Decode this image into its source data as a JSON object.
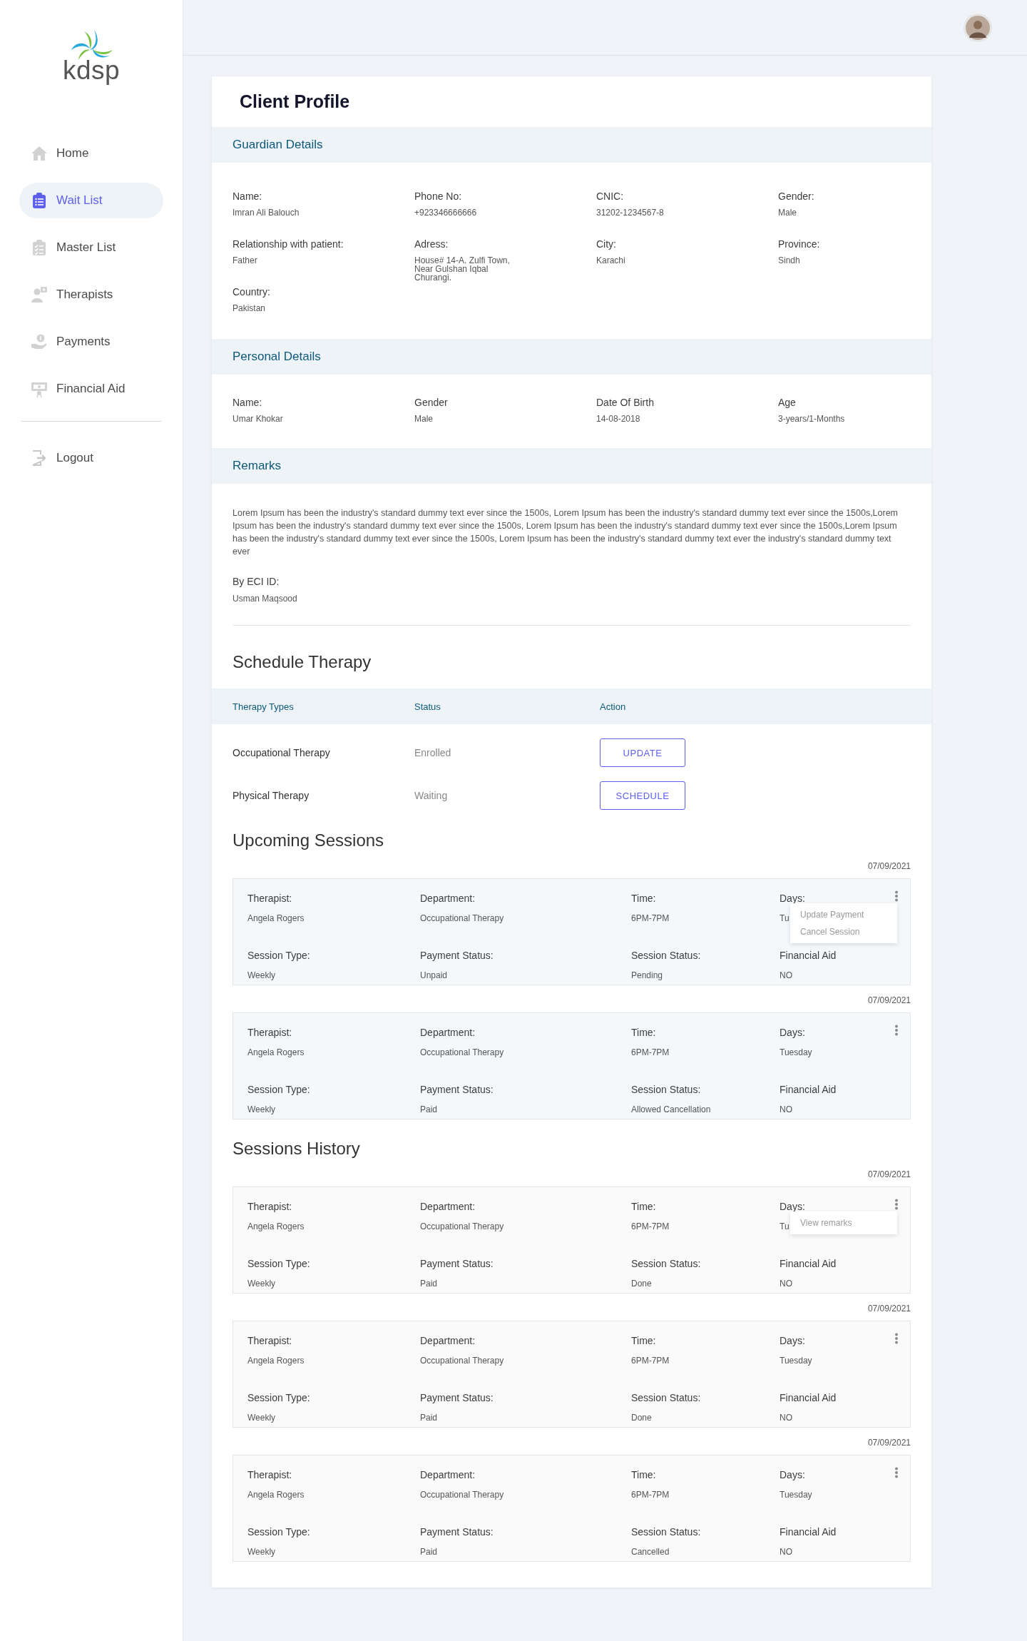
{
  "logo": {
    "text": "kdsp"
  },
  "sidebar": {
    "items": [
      {
        "label": "Home",
        "selected": false
      },
      {
        "label": "Wait List",
        "selected": true
      },
      {
        "label": "Master List",
        "selected": false
      },
      {
        "label": "Therapists",
        "selected": false
      },
      {
        "label": "Payments",
        "selected": false
      },
      {
        "label": "Financial Aid",
        "selected": false
      }
    ],
    "logout": {
      "label": "Logout"
    }
  },
  "page": {
    "title": "Client Profile"
  },
  "guardian_details": {
    "title": "Guardian Details",
    "fields": [
      {
        "label": "Name:",
        "value": "Imran Ali Balouch"
      },
      {
        "label": "Phone No:",
        "value": "+923346666666"
      },
      {
        "label": "CNIC:",
        "value": "31202-1234567-8"
      },
      {
        "label": "Gender:",
        "value": "Male"
      },
      {
        "label": "Relationship with patient:",
        "value": "Father"
      },
      {
        "label": "Adress:",
        "value": "House# 14-A. Zulfi Town, Near Gulshan Iqbal Churangi."
      },
      {
        "label": "City:",
        "value": "Karachi"
      },
      {
        "label": "Province:",
        "value": "Sindh"
      },
      {
        "label": "Country:",
        "value": "Pakistan"
      }
    ]
  },
  "personal_details": {
    "title": "Personal Details",
    "fields": [
      {
        "label": "Name:",
        "value": "Umar Khokar"
      },
      {
        "label": "Gender",
        "value": "Male"
      },
      {
        "label": "Date Of Birth",
        "value": "14-08-2018"
      },
      {
        "label": "Age",
        "value": "3-years/1-Months"
      }
    ]
  },
  "remarks": {
    "title": "Remarks",
    "text": "Lorem Ipsum has been the industry's standard dummy text ever since the 1500s, Lorem Ipsum has been the industry's standard dummy text ever since the 1500s,Lorem Ipsum has been the industry's standard dummy text ever since the 1500s, Lorem Ipsum has been the industry's standard dummy text ever since the 1500s,Lorem Ipsum has been the industry's standard dummy text ever since the 1500s, Lorem Ipsum has been the industry's standard dummy text ever the industry's standard dummy text ever",
    "by_label": "By ECI ID:",
    "by_value": "Usman Maqsood"
  },
  "schedule_therapy": {
    "title": "Schedule Therapy",
    "columns": [
      "Therapy Types",
      "Status",
      "Action"
    ],
    "rows": [
      {
        "therapy": "Occupational Therapy",
        "status": "Enrolled",
        "action": "UPDATE"
      },
      {
        "therapy": "Physical Therapy",
        "status": "Waiting",
        "action": "SCHEDULE"
      }
    ]
  },
  "upcoming_sessions": {
    "title": "Upcoming Sessions",
    "sessions": [
      {
        "date": "07/09/2021",
        "fields": [
          {
            "label": "Therapist:",
            "value": "Angela Rogers"
          },
          {
            "label": "Department:",
            "value": "Occupational Therapy"
          },
          {
            "label": "Time:",
            "value": "6PM-7PM"
          },
          {
            "label": "Days:",
            "value": "Tu"
          },
          {
            "label": "Session Type:",
            "value": "Weekly"
          },
          {
            "label": "Payment Status:",
            "value": "Unpaid"
          },
          {
            "label": "Session Status:",
            "value": "Pending"
          },
          {
            "label": "Financial Aid",
            "value": "NO"
          }
        ],
        "menu": [
          "Update Payment",
          "Cancel Session"
        ]
      },
      {
        "date": "07/09/2021",
        "fields": [
          {
            "label": "Therapist:",
            "value": "Angela Rogers"
          },
          {
            "label": "Department:",
            "value": "Occupational Therapy"
          },
          {
            "label": "Time:",
            "value": "6PM-7PM"
          },
          {
            "label": "Days:",
            "value": "Tuesday"
          },
          {
            "label": "Session Type:",
            "value": "Weekly"
          },
          {
            "label": "Payment Status:",
            "value": "Paid"
          },
          {
            "label": "Session Status:",
            "value": "Allowed Cancellation"
          },
          {
            "label": "Financial Aid",
            "value": "NO"
          }
        ]
      }
    ]
  },
  "sessions_history": {
    "title": "Sessions History",
    "sessions": [
      {
        "date": "07/09/2021",
        "fields": [
          {
            "label": "Therapist:",
            "value": "Angela Rogers"
          },
          {
            "label": "Department:",
            "value": "Occupational Therapy"
          },
          {
            "label": "Time:",
            "value": "6PM-7PM"
          },
          {
            "label": "Days:",
            "value": "Tu"
          },
          {
            "label": "Session Type:",
            "value": "Weekly"
          },
          {
            "label": "Payment Status:",
            "value": "Paid"
          },
          {
            "label": "Session Status:",
            "value": "Done"
          },
          {
            "label": "Financial Aid",
            "value": "NO"
          }
        ],
        "menu": [
          "View remarks"
        ]
      },
      {
        "date": "07/09/2021",
        "fields": [
          {
            "label": "Therapist:",
            "value": "Angela Rogers"
          },
          {
            "label": "Department:",
            "value": "Occupational Therapy"
          },
          {
            "label": "Time:",
            "value": "6PM-7PM"
          },
          {
            "label": "Days:",
            "value": "Tuesday"
          },
          {
            "label": "Session Type:",
            "value": "Weekly"
          },
          {
            "label": "Payment Status:",
            "value": "Paid"
          },
          {
            "label": "Session Status:",
            "value": "Done"
          },
          {
            "label": "Financial Aid",
            "value": "NO"
          }
        ]
      },
      {
        "date": "07/09/2021",
        "fields": [
          {
            "label": "Therapist:",
            "value": "Angela Rogers"
          },
          {
            "label": "Department:",
            "value": "Occupational Therapy"
          },
          {
            "label": "Time:",
            "value": "6PM-7PM"
          },
          {
            "label": "Days:",
            "value": "Tuesday"
          },
          {
            "label": "Session Type:",
            "value": "Weekly"
          },
          {
            "label": "Payment Status:",
            "value": "Paid"
          },
          {
            "label": "Session Status:",
            "value": "Cancelled"
          },
          {
            "label": "Financial Aid",
            "value": "NO"
          }
        ]
      }
    ]
  }
}
